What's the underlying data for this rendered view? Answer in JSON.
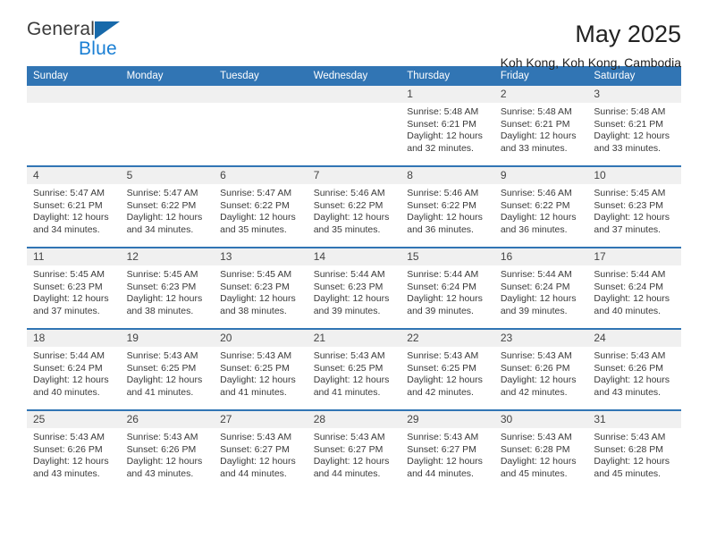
{
  "brand": {
    "name_part1": "General",
    "name_part2": "Blue"
  },
  "header": {
    "title": "May 2025",
    "subtitle": "Koh Kong, Koh Kong, Cambodia"
  },
  "colors": {
    "header_blue": "#3175b4",
    "brand_blue": "#1a7fd4",
    "daynum_band": "#f0f0f0"
  },
  "weekdays": [
    "Sunday",
    "Monday",
    "Tuesday",
    "Wednesday",
    "Thursday",
    "Friday",
    "Saturday"
  ],
  "labels": {
    "sunrise_prefix": "Sunrise:",
    "sunset_prefix": "Sunset:",
    "daylight_prefix": "Daylight:"
  },
  "weeks": [
    [
      {
        "empty": true
      },
      {
        "empty": true
      },
      {
        "empty": true
      },
      {
        "empty": true
      },
      {
        "day": "1",
        "sunrise": "Sunrise: 5:48 AM",
        "sunset": "Sunset: 6:21 PM",
        "daylight_line1": "Daylight: 12 hours",
        "daylight_line2": "and 32 minutes."
      },
      {
        "day": "2",
        "sunrise": "Sunrise: 5:48 AM",
        "sunset": "Sunset: 6:21 PM",
        "daylight_line1": "Daylight: 12 hours",
        "daylight_line2": "and 33 minutes."
      },
      {
        "day": "3",
        "sunrise": "Sunrise: 5:48 AM",
        "sunset": "Sunset: 6:21 PM",
        "daylight_line1": "Daylight: 12 hours",
        "daylight_line2": "and 33 minutes."
      }
    ],
    [
      {
        "day": "4",
        "sunrise": "Sunrise: 5:47 AM",
        "sunset": "Sunset: 6:21 PM",
        "daylight_line1": "Daylight: 12 hours",
        "daylight_line2": "and 34 minutes."
      },
      {
        "day": "5",
        "sunrise": "Sunrise: 5:47 AM",
        "sunset": "Sunset: 6:22 PM",
        "daylight_line1": "Daylight: 12 hours",
        "daylight_line2": "and 34 minutes."
      },
      {
        "day": "6",
        "sunrise": "Sunrise: 5:47 AM",
        "sunset": "Sunset: 6:22 PM",
        "daylight_line1": "Daylight: 12 hours",
        "daylight_line2": "and 35 minutes."
      },
      {
        "day": "7",
        "sunrise": "Sunrise: 5:46 AM",
        "sunset": "Sunset: 6:22 PM",
        "daylight_line1": "Daylight: 12 hours",
        "daylight_line2": "and 35 minutes."
      },
      {
        "day": "8",
        "sunrise": "Sunrise: 5:46 AM",
        "sunset": "Sunset: 6:22 PM",
        "daylight_line1": "Daylight: 12 hours",
        "daylight_line2": "and 36 minutes."
      },
      {
        "day": "9",
        "sunrise": "Sunrise: 5:46 AM",
        "sunset": "Sunset: 6:22 PM",
        "daylight_line1": "Daylight: 12 hours",
        "daylight_line2": "and 36 minutes."
      },
      {
        "day": "10",
        "sunrise": "Sunrise: 5:45 AM",
        "sunset": "Sunset: 6:23 PM",
        "daylight_line1": "Daylight: 12 hours",
        "daylight_line2": "and 37 minutes."
      }
    ],
    [
      {
        "day": "11",
        "sunrise": "Sunrise: 5:45 AM",
        "sunset": "Sunset: 6:23 PM",
        "daylight_line1": "Daylight: 12 hours",
        "daylight_line2": "and 37 minutes."
      },
      {
        "day": "12",
        "sunrise": "Sunrise: 5:45 AM",
        "sunset": "Sunset: 6:23 PM",
        "daylight_line1": "Daylight: 12 hours",
        "daylight_line2": "and 38 minutes."
      },
      {
        "day": "13",
        "sunrise": "Sunrise: 5:45 AM",
        "sunset": "Sunset: 6:23 PM",
        "daylight_line1": "Daylight: 12 hours",
        "daylight_line2": "and 38 minutes."
      },
      {
        "day": "14",
        "sunrise": "Sunrise: 5:44 AM",
        "sunset": "Sunset: 6:23 PM",
        "daylight_line1": "Daylight: 12 hours",
        "daylight_line2": "and 39 minutes."
      },
      {
        "day": "15",
        "sunrise": "Sunrise: 5:44 AM",
        "sunset": "Sunset: 6:24 PM",
        "daylight_line1": "Daylight: 12 hours",
        "daylight_line2": "and 39 minutes."
      },
      {
        "day": "16",
        "sunrise": "Sunrise: 5:44 AM",
        "sunset": "Sunset: 6:24 PM",
        "daylight_line1": "Daylight: 12 hours",
        "daylight_line2": "and 39 minutes."
      },
      {
        "day": "17",
        "sunrise": "Sunrise: 5:44 AM",
        "sunset": "Sunset: 6:24 PM",
        "daylight_line1": "Daylight: 12 hours",
        "daylight_line2": "and 40 minutes."
      }
    ],
    [
      {
        "day": "18",
        "sunrise": "Sunrise: 5:44 AM",
        "sunset": "Sunset: 6:24 PM",
        "daylight_line1": "Daylight: 12 hours",
        "daylight_line2": "and 40 minutes."
      },
      {
        "day": "19",
        "sunrise": "Sunrise: 5:43 AM",
        "sunset": "Sunset: 6:25 PM",
        "daylight_line1": "Daylight: 12 hours",
        "daylight_line2": "and 41 minutes."
      },
      {
        "day": "20",
        "sunrise": "Sunrise: 5:43 AM",
        "sunset": "Sunset: 6:25 PM",
        "daylight_line1": "Daylight: 12 hours",
        "daylight_line2": "and 41 minutes."
      },
      {
        "day": "21",
        "sunrise": "Sunrise: 5:43 AM",
        "sunset": "Sunset: 6:25 PM",
        "daylight_line1": "Daylight: 12 hours",
        "daylight_line2": "and 41 minutes."
      },
      {
        "day": "22",
        "sunrise": "Sunrise: 5:43 AM",
        "sunset": "Sunset: 6:25 PM",
        "daylight_line1": "Daylight: 12 hours",
        "daylight_line2": "and 42 minutes."
      },
      {
        "day": "23",
        "sunrise": "Sunrise: 5:43 AM",
        "sunset": "Sunset: 6:26 PM",
        "daylight_line1": "Daylight: 12 hours",
        "daylight_line2": "and 42 minutes."
      },
      {
        "day": "24",
        "sunrise": "Sunrise: 5:43 AM",
        "sunset": "Sunset: 6:26 PM",
        "daylight_line1": "Daylight: 12 hours",
        "daylight_line2": "and 43 minutes."
      }
    ],
    [
      {
        "day": "25",
        "sunrise": "Sunrise: 5:43 AM",
        "sunset": "Sunset: 6:26 PM",
        "daylight_line1": "Daylight: 12 hours",
        "daylight_line2": "and 43 minutes."
      },
      {
        "day": "26",
        "sunrise": "Sunrise: 5:43 AM",
        "sunset": "Sunset: 6:26 PM",
        "daylight_line1": "Daylight: 12 hours",
        "daylight_line2": "and 43 minutes."
      },
      {
        "day": "27",
        "sunrise": "Sunrise: 5:43 AM",
        "sunset": "Sunset: 6:27 PM",
        "daylight_line1": "Daylight: 12 hours",
        "daylight_line2": "and 44 minutes."
      },
      {
        "day": "28",
        "sunrise": "Sunrise: 5:43 AM",
        "sunset": "Sunset: 6:27 PM",
        "daylight_line1": "Daylight: 12 hours",
        "daylight_line2": "and 44 minutes."
      },
      {
        "day": "29",
        "sunrise": "Sunrise: 5:43 AM",
        "sunset": "Sunset: 6:27 PM",
        "daylight_line1": "Daylight: 12 hours",
        "daylight_line2": "and 44 minutes."
      },
      {
        "day": "30",
        "sunrise": "Sunrise: 5:43 AM",
        "sunset": "Sunset: 6:28 PM",
        "daylight_line1": "Daylight: 12 hours",
        "daylight_line2": "and 45 minutes."
      },
      {
        "day": "31",
        "sunrise": "Sunrise: 5:43 AM",
        "sunset": "Sunset: 6:28 PM",
        "daylight_line1": "Daylight: 12 hours",
        "daylight_line2": "and 45 minutes."
      }
    ]
  ]
}
